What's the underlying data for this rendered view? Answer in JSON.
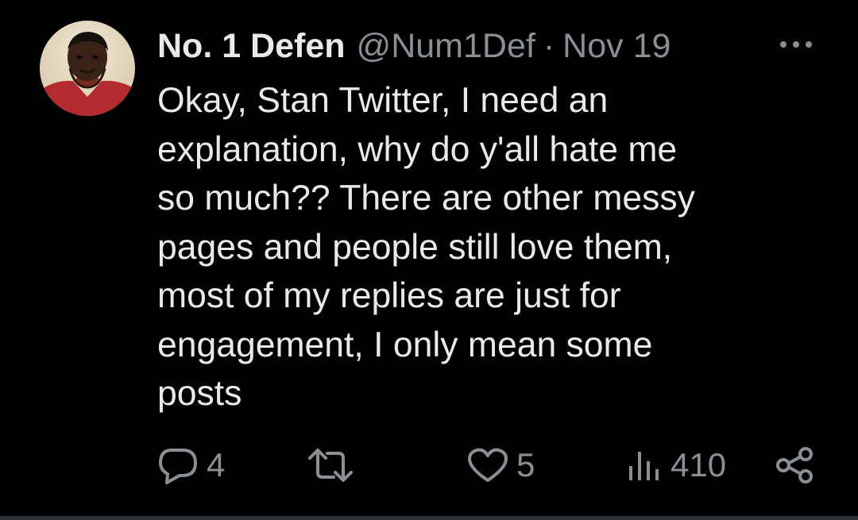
{
  "tweet": {
    "author": {
      "display_name": "No. 1 Defen",
      "handle": "@Num1Def",
      "avatar_icon": "user-avatar-photo"
    },
    "separator": "·",
    "timestamp": "Nov 19",
    "more_icon": "ellipsis-icon",
    "text_lines": [
      "Okay, Stan Twitter, I need an",
      "explanation, why do y'all hate me",
      "so much?? There are other messy",
      "pages and people still love them,",
      "most of my replies are just for",
      "engagement, I only mean some",
      "posts"
    ],
    "actions": {
      "reply": {
        "icon": "reply-bubble-icon",
        "count": "4"
      },
      "retweet": {
        "icon": "retweet-icon",
        "count": ""
      },
      "like": {
        "icon": "heart-icon",
        "count": "5"
      },
      "views": {
        "icon": "views-bar-chart-icon",
        "count": "410"
      },
      "share": {
        "icon": "share-nodes-icon"
      }
    }
  },
  "colors": {
    "background": "#000000",
    "primary_text": "#e7e9ea",
    "secondary_text": "#8b8f93",
    "divider": "#2f3336"
  }
}
